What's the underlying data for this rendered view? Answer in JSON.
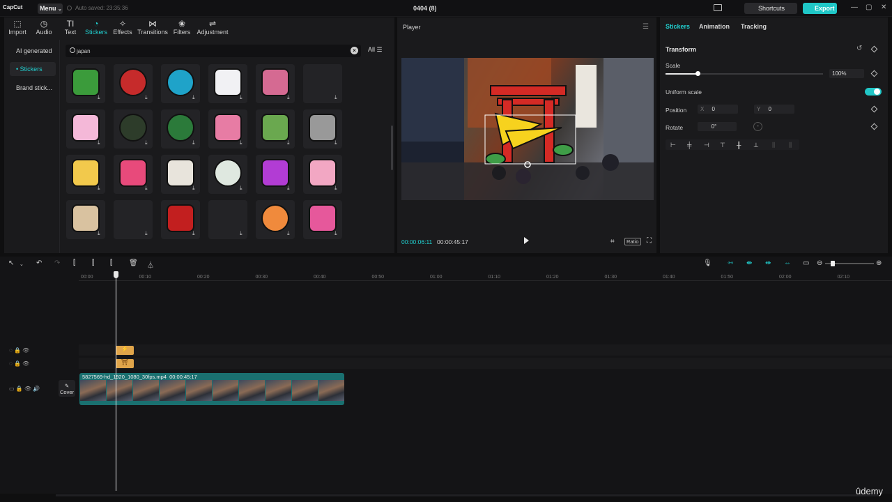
{
  "app": {
    "logo": "CapCut",
    "menu_label": "Menu",
    "autosave": "Auto saved: 23:35:36",
    "project_title": "0404 (8)",
    "shortcuts_label": "Shortcuts",
    "export_label": "Export"
  },
  "media_toolbar": {
    "tabs": [
      {
        "label": "Import",
        "icon": "import-icon"
      },
      {
        "label": "Audio",
        "icon": "audio-icon"
      },
      {
        "label": "Text",
        "icon": "text-icon"
      },
      {
        "label": "Stickers",
        "icon": "stickers-icon"
      },
      {
        "label": "Effects",
        "icon": "effects-icon"
      },
      {
        "label": "Transitions",
        "icon": "transitions-icon"
      },
      {
        "label": "Filters",
        "icon": "filters-icon"
      },
      {
        "label": "Adjustment",
        "icon": "adjustment-icon"
      }
    ],
    "active_tab": "Stickers"
  },
  "sidebar": {
    "items": [
      {
        "label": "AI generated"
      },
      {
        "label": "• Stickers"
      },
      {
        "label": "Brand stick..."
      }
    ]
  },
  "search": {
    "value": "japan",
    "filter_label": "All"
  },
  "stickers": [
    "japan-map",
    "mount-fuji",
    "japan-badge",
    "snowman",
    "torii-gate",
    "empty",
    "cherry-blossom",
    "sushi-roll",
    "food-bowl",
    "koinobori",
    "pagoda",
    "sparkles",
    "dango",
    "folding-fan",
    "japan-flag",
    "fuji-circle",
    "candy-star",
    "lantern",
    "torii-stamp",
    "empty",
    "red-umbrella",
    "empty",
    "salmon-sushi",
    "blossom-branch"
  ],
  "player": {
    "title": "Player",
    "current_time": "00:00:06:11",
    "total_time": "00:00:45:17",
    "ratio_label": "Ratio"
  },
  "properties": {
    "tabs": [
      "Stickers",
      "Animation",
      "Tracking"
    ],
    "active_tab": "Stickers",
    "section": "Transform",
    "scale_label": "Scale",
    "scale_value": "100%",
    "uniform_scale_label": "Uniform scale",
    "position_label": "Position",
    "pos_x_label": "X",
    "pos_x": "0",
    "pos_y_label": "Y",
    "pos_y": "0",
    "rotate_label": "Rotate",
    "rotate_value": "0°",
    "accent": "#21d0d0"
  },
  "timeline": {
    "ruler": [
      "00:00",
      "00:10",
      "00:20",
      "00:30",
      "00:40",
      "00:50",
      "01:00",
      "01:10",
      "01:20",
      "01:30",
      "01:40",
      "01:50",
      "02:00",
      "02:10"
    ],
    "clip_name": "5827569-hd_1920_1080_30fps.mp4",
    "clip_duration": "00:00:45:17",
    "cover_label": "Cover"
  },
  "watermark": "ûdemy"
}
